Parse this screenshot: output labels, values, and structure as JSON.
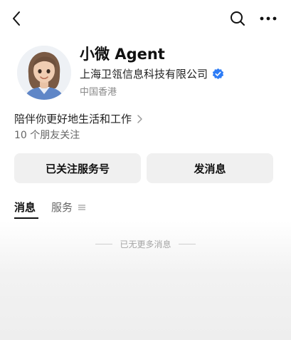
{
  "nav": {
    "back_icon": "chevron-left-icon",
    "search_icon": "search-icon",
    "more_icon": "more-horizontal-icon"
  },
  "profile": {
    "name": "小微 Agent",
    "organization": "上海卫瓴信息科技有限公司",
    "verified_icon": "verified-badge-icon",
    "verified_color": "#2d7cf6",
    "region": "中国香港",
    "bio": "陪伴你更好地生活和工作",
    "friends_following": "10 个朋友关注"
  },
  "actions": {
    "follow_label": "已关注服务号",
    "message_label": "发消息"
  },
  "tabs": [
    {
      "label": "消息",
      "active": true
    },
    {
      "label": "服务",
      "active": false
    }
  ],
  "feed": {
    "end_text": "已无更多消息"
  }
}
